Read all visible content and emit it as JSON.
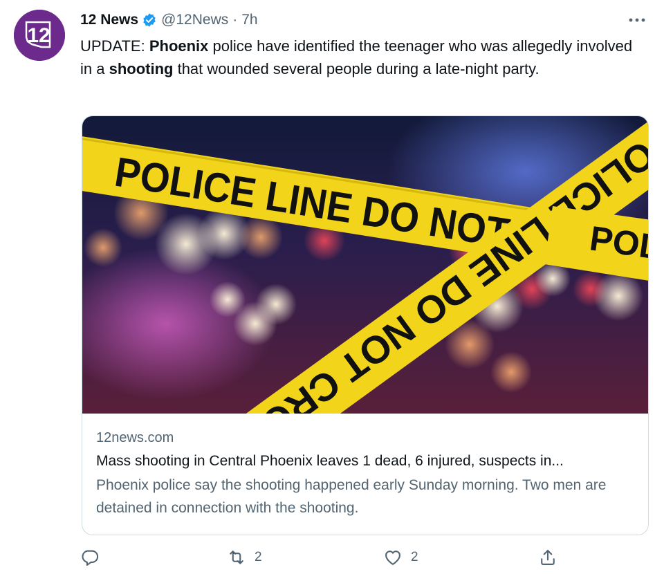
{
  "tweet": {
    "avatar": {
      "icon": "12-news-logo",
      "logo_text": "12",
      "brand_color": "#6b2a8c"
    },
    "author": {
      "display_name": "12 News",
      "handle": "@12News",
      "separator": "·",
      "time": "7h",
      "verified": true,
      "verified_color": "#1d9bf0"
    },
    "text": {
      "p1": "UPDATE: ",
      "b1": "Phoenix",
      "p2": " police have identified the teenager who was allegedly involved in a ",
      "b2": "shooting",
      "p3": " that wounded several people during a late-night party."
    },
    "card": {
      "image": {
        "icon": "police-tape-photo",
        "tape_text_1": "POLICE LINE DO NOT CROSS",
        "tape_text_2": "POLICE LINE DO NOT CROSS",
        "tape_text_3": "POL"
      },
      "domain": "12news.com",
      "title": "Mass shooting in Central Phoenix leaves 1 dead, 6 injured, suspects in...",
      "description": "Phoenix police say the shooting happened early Sunday morning. Two men are detained in connection with the shooting."
    },
    "actions": {
      "reply": {
        "icon": "reply-icon",
        "count": ""
      },
      "retweet": {
        "icon": "retweet-icon",
        "count": "2"
      },
      "like": {
        "icon": "heart-icon",
        "count": "2"
      },
      "share": {
        "icon": "share-icon",
        "count": ""
      }
    },
    "colors": {
      "secondary_text": "#536471",
      "primary_text": "#0f1419",
      "border": "#cfd9de"
    }
  }
}
